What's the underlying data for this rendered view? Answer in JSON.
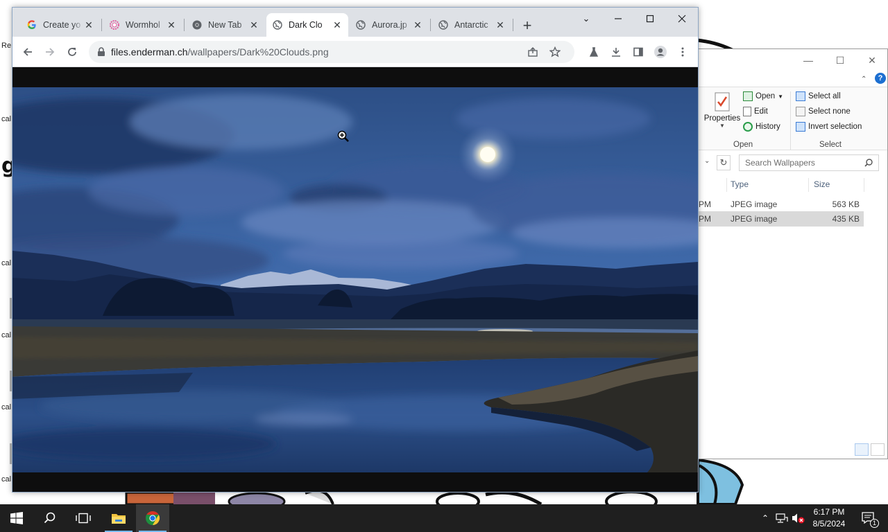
{
  "desktop": {
    "fragments": [
      "Re",
      "cal",
      "cal",
      "cal",
      "cal",
      "cal",
      "cal"
    ],
    "big_letter": "g"
  },
  "explorer": {
    "controls": {
      "minimize": "—",
      "maximize": "☐",
      "close": "✕"
    },
    "help": "?",
    "ribbon": {
      "properties_label": "Properties",
      "open_label": "Open",
      "edit_label": "Edit",
      "history_label": "History",
      "open_group": "Open",
      "select_all": "Select all",
      "select_none": "Select none",
      "invert_selection": "Invert selection",
      "select_group": "Select"
    },
    "search_placeholder": "Search Wallpapers",
    "columns": {
      "type": "Type",
      "size": "Size"
    },
    "files": [
      {
        "time": "PM",
        "type": "JPEG image",
        "size": "563 KB",
        "selected": false
      },
      {
        "time": "PM",
        "type": "JPEG image",
        "size": "435 KB",
        "selected": true
      }
    ]
  },
  "chrome": {
    "tabs": [
      {
        "title": "Create yo",
        "icon": "google-icon",
        "active": false
      },
      {
        "title": "Wormhol",
        "icon": "flower-icon",
        "active": false
      },
      {
        "title": "New Tab",
        "icon": "chrome-icon",
        "active": false
      },
      {
        "title": "Dark Clo",
        "icon": "globe-icon",
        "active": true
      },
      {
        "title": "Aurora.jp",
        "icon": "globe-icon",
        "active": false
      },
      {
        "title": "Antarctic",
        "icon": "globe-icon",
        "active": false
      }
    ],
    "new_tab": "+",
    "url": {
      "host": "files.enderman.ch",
      "path": "/wallpapers/Dark%20Clouds.png"
    }
  },
  "taskbar": {
    "clock": {
      "time": "6:17 PM",
      "date": "8/5/2024"
    },
    "notification_count": "1"
  },
  "colors": {
    "taskbar_bg": "#1f1f1f",
    "tabstrip_bg": "#dee1e6",
    "viewport_bg": "#0e0e0e",
    "accent": "#1a73e8"
  }
}
